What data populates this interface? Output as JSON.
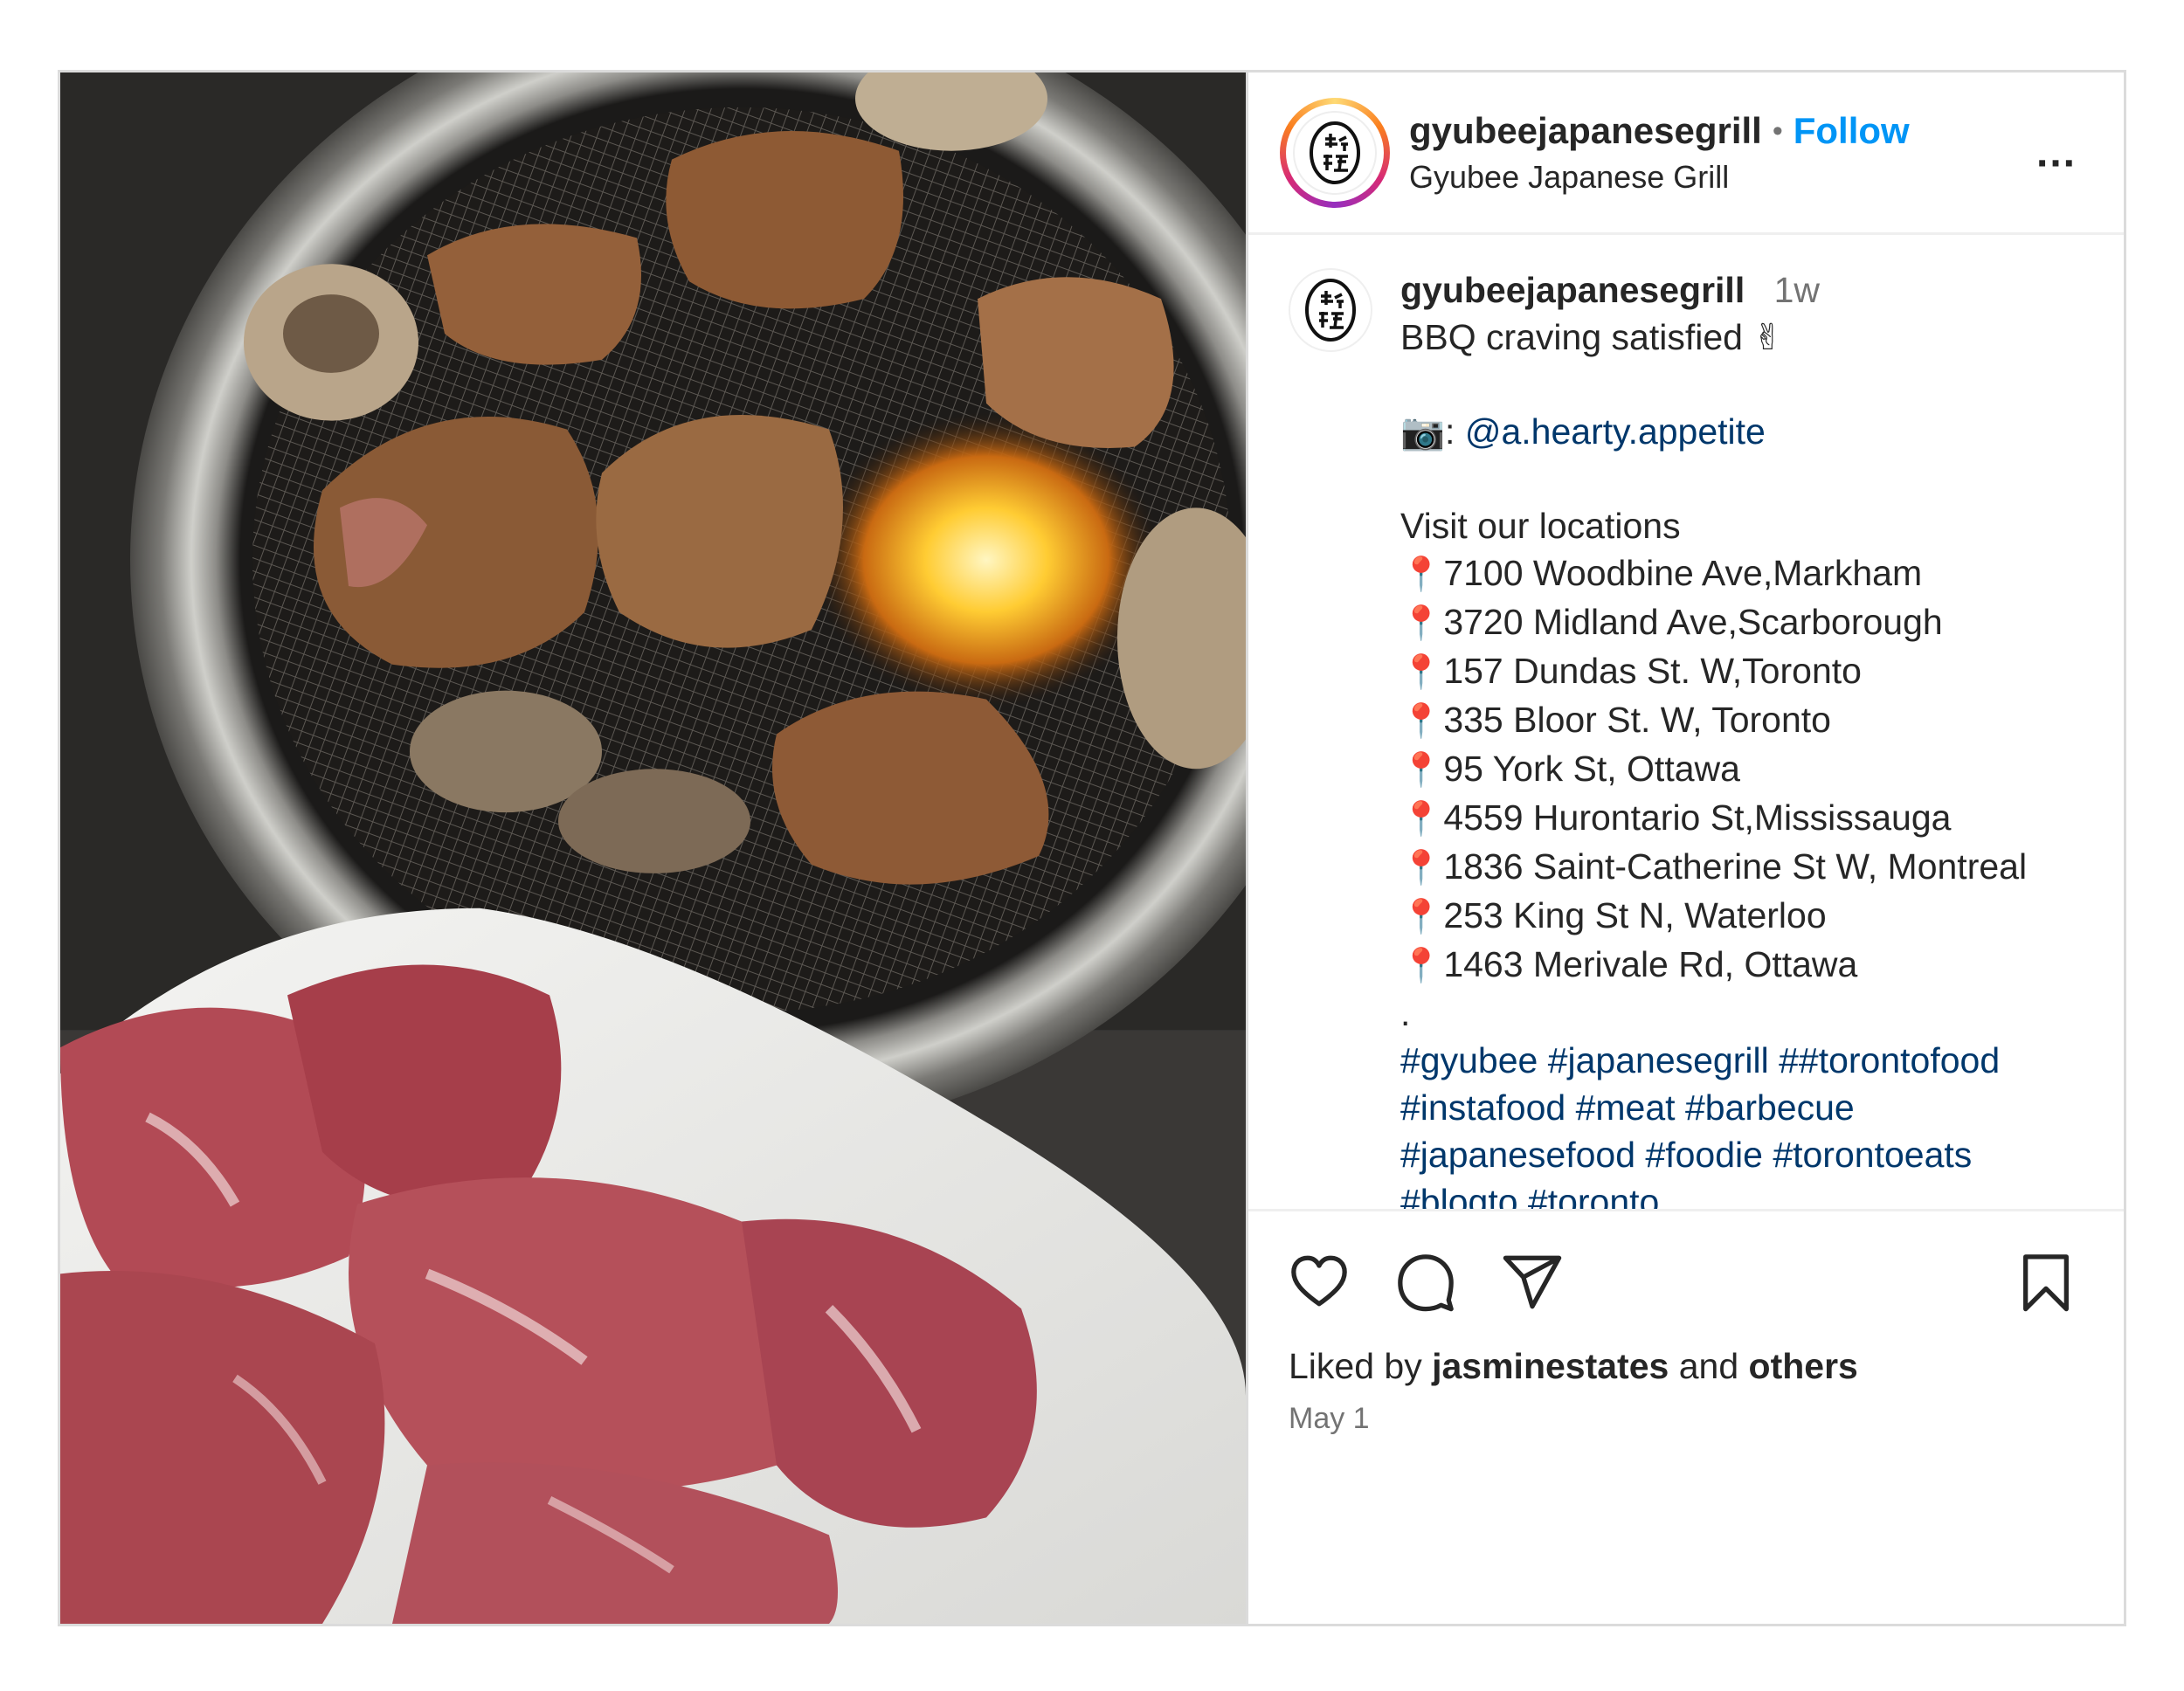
{
  "header": {
    "username": "gyubeejapanesegrill",
    "separator": "•",
    "follow_label": "Follow",
    "subtitle": "Gyubee Japanese Grill",
    "more_label": "..."
  },
  "caption": {
    "username": "gyubeejapanesegrill",
    "time": "1w",
    "line1": "BBQ craving satisfied ✌",
    "credit_prefix": "📷: ",
    "credit_mention": "@a.hearty.appetite",
    "visit": "Visit our locations",
    "pin_glyph": "📍",
    "locations": [
      "7100 Woodbine Ave,Markham",
      "3720 Midland Ave,Scarborough",
      "157 Dundas St. W,Toronto",
      "335 Bloor St. W, Toronto",
      "95 York St, Ottawa",
      "4559 Hurontario St,Mississauga",
      "1836 Saint-Catherine St W, Montreal",
      "253 King St N, Waterloo",
      "1463 Merivale Rd, Ottawa"
    ],
    "dot_line": ".",
    "hashtag_lines": [
      "#gyubee #japanesegrill ##torontofood",
      "#instafood #meat #barbecue",
      "#japanesefood #foodie #torontoeats",
      "#blogto #toronto"
    ]
  },
  "actions": {
    "icons": [
      "heart-icon",
      "comment-icon",
      "share-icon",
      "bookmark-icon"
    ]
  },
  "likes": {
    "prefix": "Liked by ",
    "user": "jasminestates",
    "middle": " and ",
    "others": "others"
  },
  "date": "May 1",
  "colors": {
    "follow": "#0095f6",
    "link": "#00376b",
    "muted": "#737373",
    "border": "#dbdbdb"
  }
}
